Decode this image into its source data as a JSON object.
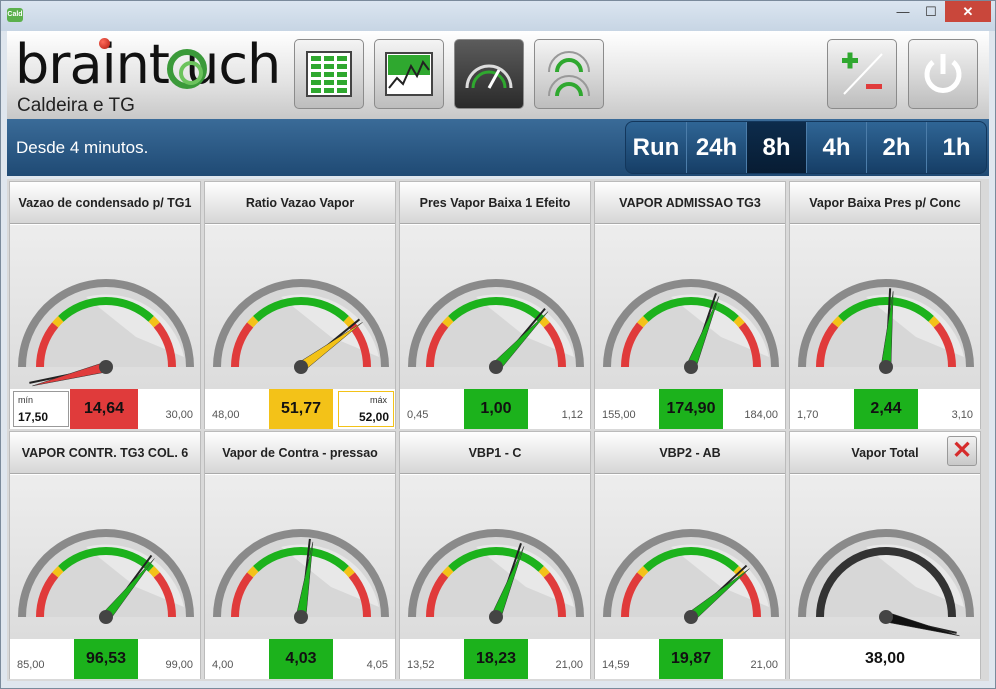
{
  "window": {
    "icon_label": "Cald",
    "min": "—",
    "max": "☐",
    "close": "✕"
  },
  "header": {
    "logo_text": "braint uch",
    "subtitle": "Caldeira e TG"
  },
  "infobar": {
    "since": "Desde 4 minutos.",
    "ranges": [
      "Run",
      "24h",
      "8h",
      "4h",
      "2h",
      "1h"
    ],
    "active_range": "8h"
  },
  "colors": {
    "green": "#1cb21c",
    "red": "#e03b3b",
    "yellow": "#f3c218",
    "accent": "#1f4a74"
  },
  "gauges": [
    {
      "title": "Vazao de condensado p/ TG1",
      "min": "17,50",
      "max": "30,00",
      "value": "14,64",
      "status": "red",
      "needle": -0.08,
      "min_label": "mín",
      "min_box": "17,50",
      "max_label": "",
      "max_box": ""
    },
    {
      "title": "Ratio Vazao Vapor",
      "min": "48,00",
      "max": "",
      "value": "51,77",
      "status": "yellow",
      "needle": 0.8,
      "min_label": "",
      "min_box": "",
      "max_label": "máx",
      "max_box": "52,00"
    },
    {
      "title": "Pres Vapor Baixa 1 Efeito",
      "min": "0,45",
      "max": "1,12",
      "value": "1,00",
      "status": "green",
      "needle": 0.74,
      "min_label": "",
      "min_box": "",
      "max_label": "",
      "max_box": ""
    },
    {
      "title": "VAPOR ADMISSAO TG3",
      "min": "155,00",
      "max": "184,00",
      "value": "174,90",
      "status": "green",
      "needle": 0.62,
      "min_label": "",
      "min_box": "",
      "max_label": "",
      "max_box": ""
    },
    {
      "title": "Vapor Baixa Pres p/ Conc",
      "min": "1,70",
      "max": "3,10",
      "value": "2,44",
      "status": "green",
      "needle": 0.53,
      "min_label": "",
      "min_box": "",
      "max_label": "",
      "max_box": ""
    },
    {
      "title": "VAPOR CONTR. TG3 COL. 6",
      "min": "85,00",
      "max": "99,00",
      "value": "96,53",
      "status": "green",
      "needle": 0.72,
      "min_label": "",
      "min_box": "",
      "max_label": "",
      "max_box": ""
    },
    {
      "title": "Vapor de Contra - pressao",
      "min": "4,00",
      "max": "4,05",
      "value": "4,03",
      "status": "green",
      "needle": 0.55,
      "min_label": "",
      "min_box": "",
      "max_label": "",
      "max_box": ""
    },
    {
      "title": "VBP1 - C",
      "min": "13,52",
      "max": "21,00",
      "value": "18,23",
      "status": "green",
      "needle": 0.62,
      "min_label": "",
      "min_box": "",
      "max_label": "",
      "max_box": ""
    },
    {
      "title": "VBP2 - AB",
      "min": "14,59",
      "max": "21,00",
      "value": "19,87",
      "status": "green",
      "needle": 0.78,
      "min_label": "",
      "min_box": "",
      "max_label": "",
      "max_box": ""
    },
    {
      "title": "Vapor Total",
      "min": "",
      "max": "",
      "value": "38,00",
      "status": "plain",
      "needle": 1.08,
      "min_label": "",
      "min_box": "",
      "max_label": "",
      "max_box": "",
      "closable": true,
      "close_label": "✕"
    }
  ]
}
